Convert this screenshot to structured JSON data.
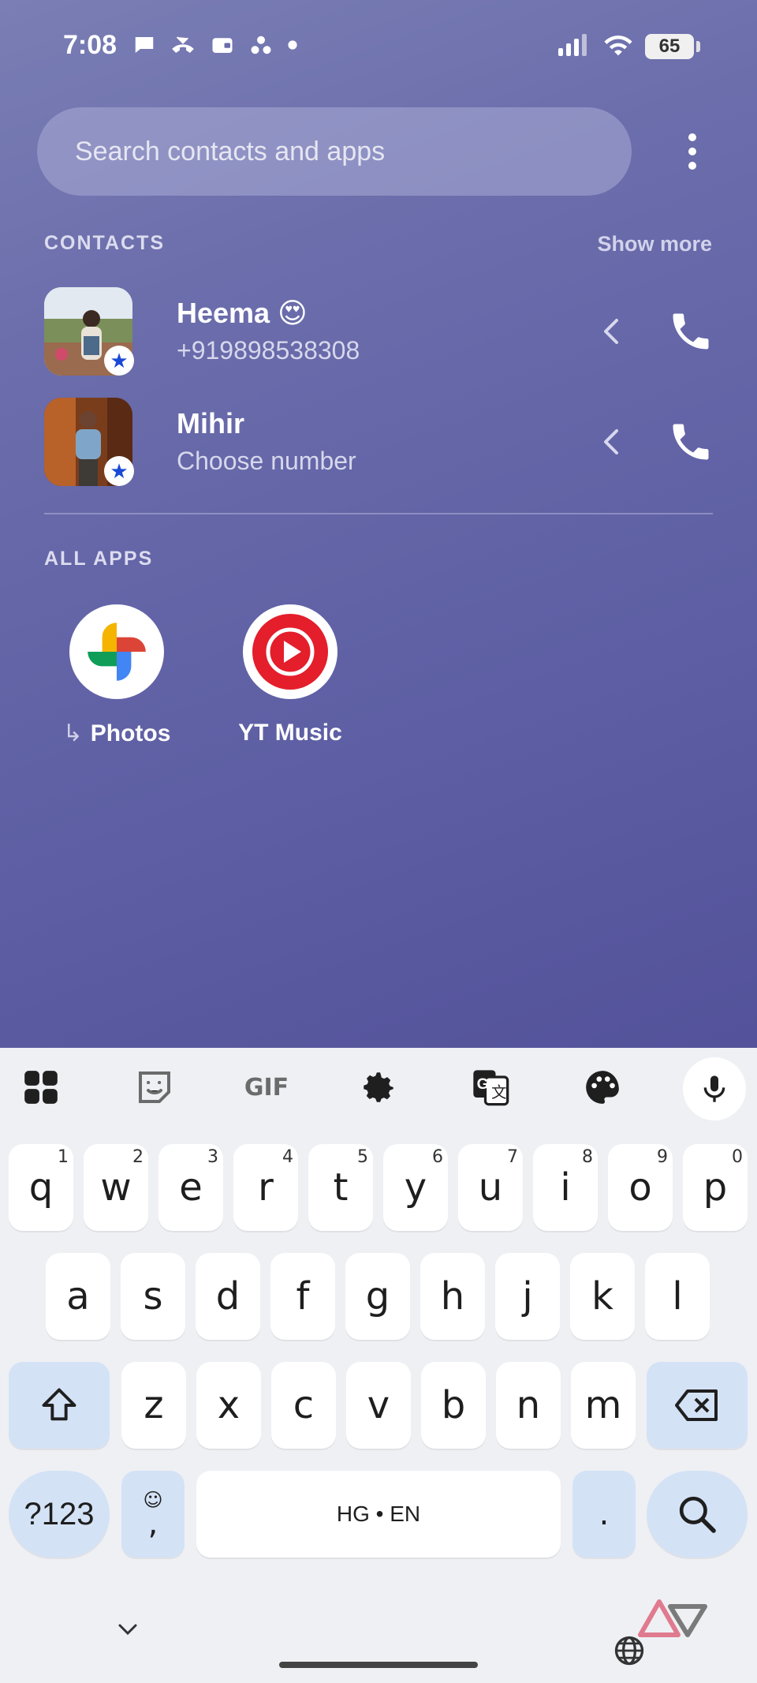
{
  "status_bar": {
    "time": "7:08",
    "battery": "65"
  },
  "search": {
    "placeholder": "Search contacts and apps"
  },
  "contacts_section": {
    "label": "CONTACTS",
    "show_more": "Show more",
    "items": [
      {
        "name": "Heema 😍",
        "sub": "+919898538308"
      },
      {
        "name": "Mihir",
        "sub": "Choose number"
      }
    ]
  },
  "apps_section": {
    "label": "ALL APPS",
    "items": [
      {
        "label": "Photos"
      },
      {
        "label": "YT Music"
      }
    ]
  },
  "keyboard": {
    "row1": [
      {
        "k": "q",
        "h": "1"
      },
      {
        "k": "w",
        "h": "2"
      },
      {
        "k": "e",
        "h": "3"
      },
      {
        "k": "r",
        "h": "4"
      },
      {
        "k": "t",
        "h": "5"
      },
      {
        "k": "y",
        "h": "6"
      },
      {
        "k": "u",
        "h": "7"
      },
      {
        "k": "i",
        "h": "8"
      },
      {
        "k": "o",
        "h": "9"
      },
      {
        "k": "p",
        "h": "0"
      }
    ],
    "row2": [
      "a",
      "s",
      "d",
      "f",
      "g",
      "h",
      "j",
      "k",
      "l"
    ],
    "row3": [
      "z",
      "x",
      "c",
      "v",
      "b",
      "n",
      "m"
    ],
    "symbols_label": "?123",
    "comma_label": ",",
    "space_label": "HG • EN",
    "period_label": ".",
    "gif_label": "GIF"
  },
  "colors": {
    "accent_blue": "#d4e2f6",
    "star_blue": "#1a49d6",
    "yt_red": "#e41e2b"
  }
}
